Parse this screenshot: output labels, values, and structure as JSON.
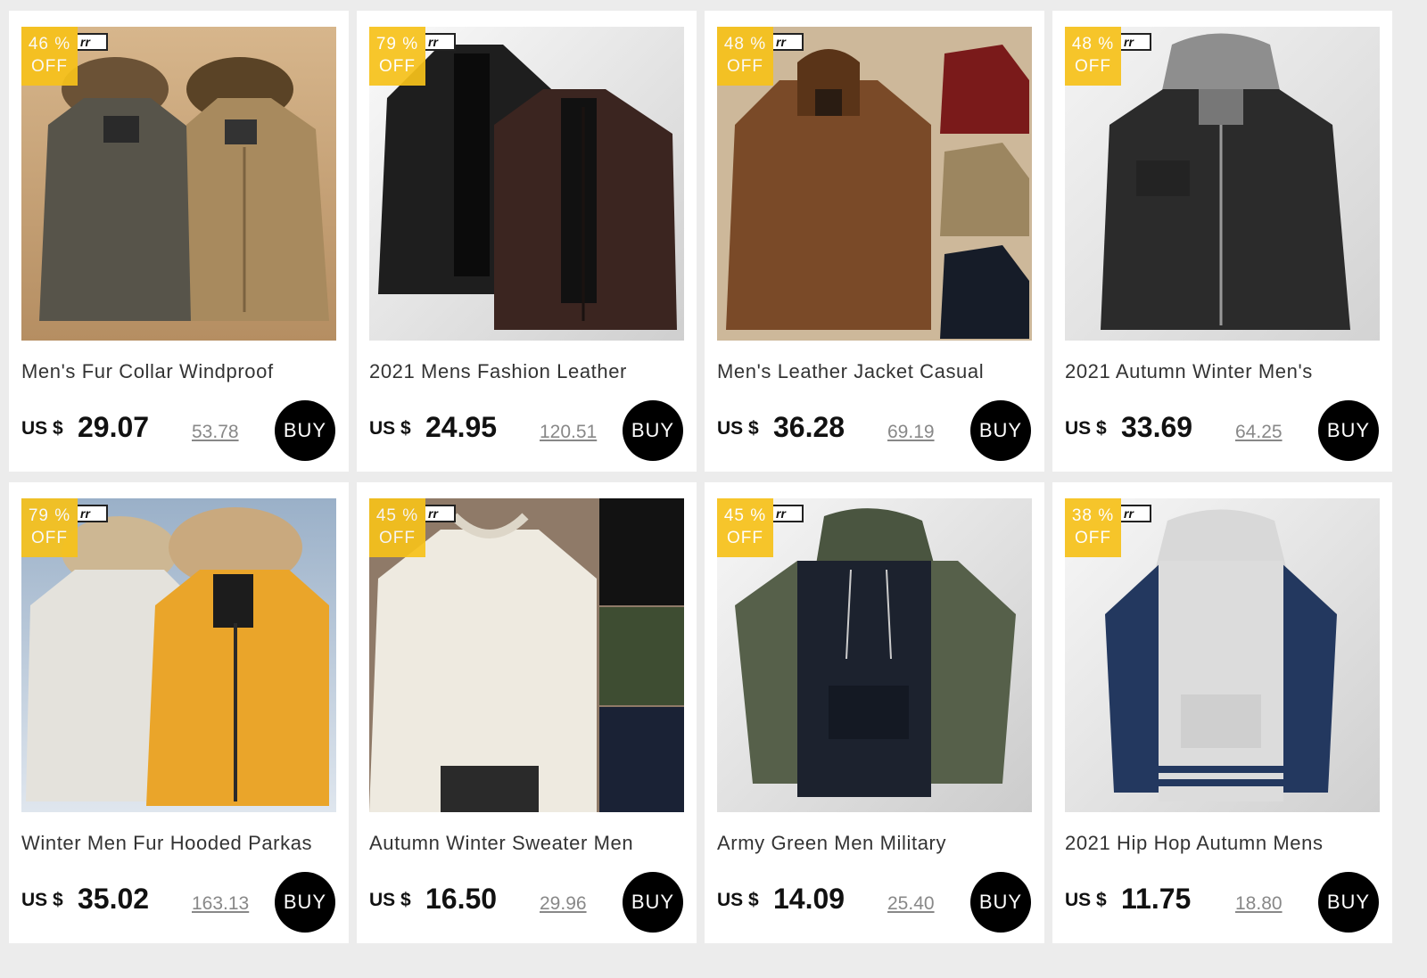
{
  "brand_mark": "rr",
  "labels": {
    "currency": "US $",
    "off": "OFF",
    "buy": "BUY",
    "percent_suffix": " %"
  },
  "products": [
    {
      "title": "Men's Fur Collar Windproof",
      "price": "29.07",
      "old_price": "53.78",
      "discount": "46",
      "image": "fur-collar-parka-photo"
    },
    {
      "title": "2021 Mens Fashion Leather",
      "price": "24.95",
      "old_price": "120.51",
      "discount": "79",
      "image": "leather-jacket-photo"
    },
    {
      "title": "Men's Leather Jacket Casual",
      "price": "36.28",
      "old_price": "69.19",
      "discount": "48",
      "image": "hooded-leather-jacket-photo"
    },
    {
      "title": "2021 Autumn Winter Men's",
      "price": "33.69",
      "old_price": "64.25",
      "discount": "48",
      "image": "black-hooded-jacket-photo"
    },
    {
      "title": "Winter Men Fur Hooded Parkas",
      "price": "35.02",
      "old_price": "163.13",
      "discount": "79",
      "image": "winter-parka-photo"
    },
    {
      "title": "Autumn Winter Sweater Men",
      "price": "16.50",
      "old_price": "29.96",
      "discount": "45",
      "image": "knit-sweater-photo"
    },
    {
      "title": "Army Green Men Military",
      "price": "14.09",
      "old_price": "25.40",
      "discount": "45",
      "image": "camo-hoodie-photo"
    },
    {
      "title": "2021 Hip Hop Autumn Mens",
      "price": "11.75",
      "old_price": "18.80",
      "discount": "38",
      "image": "raglan-hoodie-photo"
    }
  ]
}
